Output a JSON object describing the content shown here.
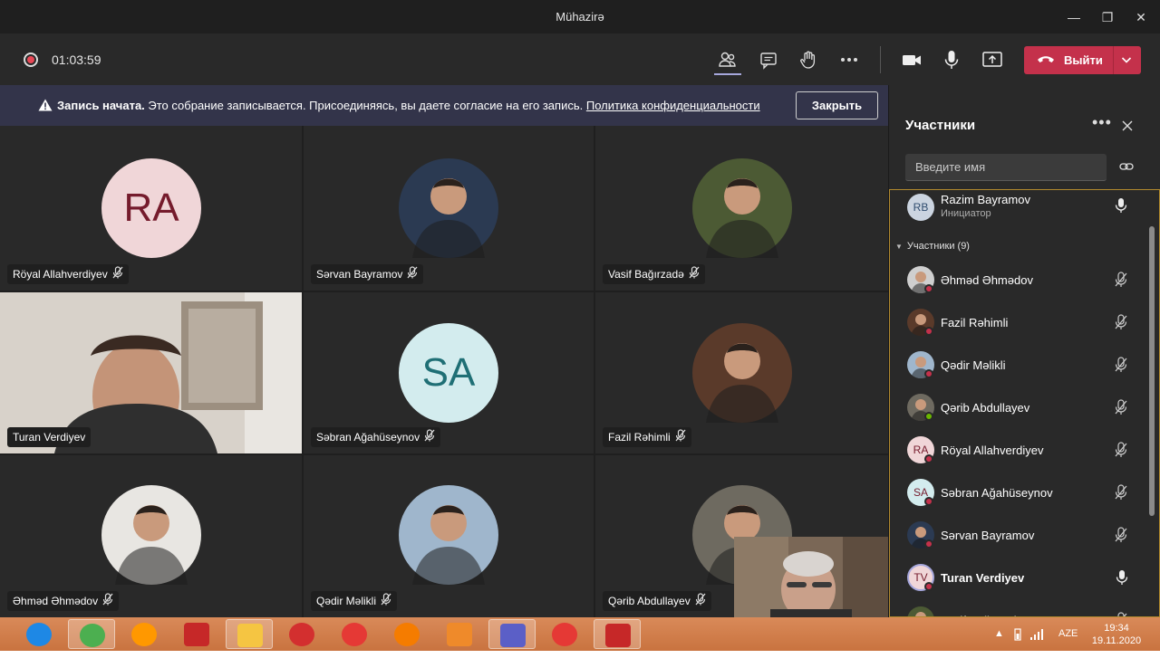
{
  "window": {
    "title": "Mühazirə",
    "minimize": "—",
    "maximize": "❐",
    "close": "✕"
  },
  "meeting": {
    "timer": "01:03:59",
    "leave_label": "Выйти"
  },
  "banner": {
    "bold": "Запись начата.",
    "text": " Это собрание записывается. Присоединяясь, вы даете согласие на его запись. ",
    "link": "Политика конфиденциальности",
    "close_label": "Закрыть"
  },
  "tiles": [
    {
      "name": "Röyal Allahverdiyev",
      "initials": "RA",
      "kind": "initials",
      "bg": "#f0d6d8",
      "fg": "#751b2c"
    },
    {
      "name": "Sərvan Bayramov",
      "kind": "photo",
      "bg": "#2b3a52"
    },
    {
      "name": "Vasif Bağırzadə",
      "kind": "photo",
      "bg": "#4c5a34"
    },
    {
      "name": "Turan Verdiyev",
      "kind": "video"
    },
    {
      "name": "Səbran Ağahüseynov",
      "initials": "SA",
      "kind": "initials",
      "bg": "#d3ecee",
      "fg": "#1f6f75"
    },
    {
      "name": "Fazil Rəhimli",
      "kind": "photo",
      "bg": "#5a3a2a"
    },
    {
      "name": "Əhməd Əhmədov",
      "kind": "photo",
      "bg": "#e8e6e2"
    },
    {
      "name": "Qədir Məlikli",
      "kind": "photo",
      "bg": "#9fb6cc"
    },
    {
      "name": "Qərib Abdullayev",
      "kind": "photo",
      "bg": "#6e6a60"
    }
  ],
  "roster": {
    "title": "Участники",
    "search_placeholder": "Введите имя",
    "organizer": {
      "name": "Razim Bayramov",
      "role": "Инициатор",
      "initials": "RB"
    },
    "section_label": "Участники (9)",
    "people": [
      {
        "name": "Əhməd Əhmədov",
        "initials": "",
        "avatar_bg": "#cfcfcf",
        "status": "#c4314b",
        "bold": false
      },
      {
        "name": "Fazil Rəhimli",
        "initials": "",
        "avatar_bg": "#5a3a2a",
        "status": "#c4314b",
        "bold": false
      },
      {
        "name": "Qədir Məlikli",
        "initials": "",
        "avatar_bg": "#9fb6cc",
        "status": "#c4314b",
        "bold": false
      },
      {
        "name": "Qərib Abdullayev",
        "initials": "",
        "avatar_bg": "#6e6a60",
        "status": "#6bb700",
        "bold": false
      },
      {
        "name": "Röyal Allahverdiyev",
        "initials": "RA",
        "avatar_bg": "#f0d6d8",
        "status": "#c4314b",
        "bold": false
      },
      {
        "name": "Səbran Ağahüseynov",
        "initials": "SA",
        "avatar_bg": "#d3ecee",
        "status": "#c4314b",
        "bold": false
      },
      {
        "name": "Sərvan Bayramov",
        "initials": "",
        "avatar_bg": "#2b3a52",
        "status": "#c4314b",
        "bold": false
      },
      {
        "name": "Turan Verdiyev",
        "initials": "TV",
        "avatar_bg": "#f0d6d8",
        "status": "#c4314b",
        "bold": true
      },
      {
        "name": "Vasif Bağırzadə",
        "initials": "",
        "avatar_bg": "#4c5a34",
        "status": "#c4314b",
        "bold": false
      }
    ]
  },
  "taskbar": {
    "apps": [
      "internet-explorer",
      "chrome",
      "firefox-alt",
      "autocad",
      "file-explorer",
      "opera",
      "yandex",
      "settings",
      "media-player",
      "teams",
      "yandex-browser",
      "acrobat"
    ],
    "language": "AZE",
    "time": "19:34",
    "date": "19.11.2020"
  },
  "colors": {
    "accent": "#a6a7dc",
    "leave": "#c4314b",
    "banner": "#33344a",
    "panel": "#292929"
  }
}
